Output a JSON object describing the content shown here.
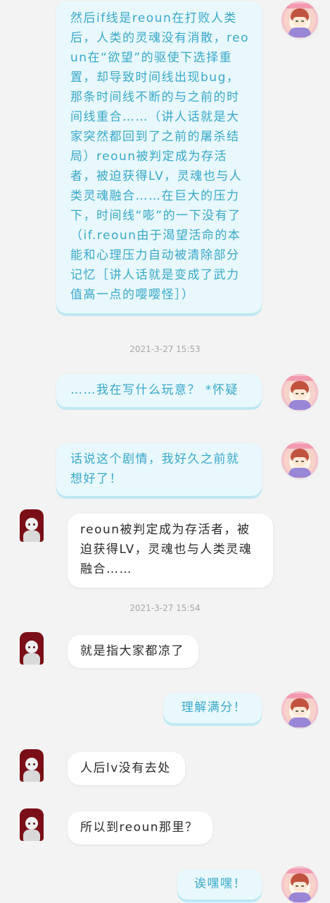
{
  "messages": [
    {
      "id": "m1",
      "side": "me",
      "text": "然后if线是reoun在打败人类后，人类的灵魂没有消散，reoun在“欲望”的驱使下选择重置，却导致时间线出现bug，那条时间线不断的与之前的时间线重合……（讲人话就是大家突然都回到了之前的屠杀结局）reoun被判定成为存活者，被迫获得LV，灵魂也与人类灵魂融合……在巨大的压力下，时间线“嘭”的一下没有了（if.reoun由于渴望活命的本能和心理压力自动被清除部分记忆［讲人话就是变成了武力值高一点的嘤嘤怪］）"
    },
    {
      "id": "t1",
      "type": "time",
      "text": "2021-3-27 15:53"
    },
    {
      "id": "m2",
      "side": "me",
      "text": "……我在写什么玩意？ *怀疑"
    },
    {
      "id": "m3",
      "side": "me",
      "text": "话说这个剧情，我好久之前就想好了！"
    },
    {
      "id": "m4",
      "side": "them",
      "text": "reoun被判定成为存活者，被迫获得LV，灵魂也与人类灵魂融合……"
    },
    {
      "id": "t2",
      "type": "time",
      "text": "2021-3-27 15:54"
    },
    {
      "id": "m5",
      "side": "them",
      "text": "就是指大家都凉了"
    },
    {
      "id": "m6",
      "side": "me",
      "text": "理解满分！"
    },
    {
      "id": "m7",
      "side": "them",
      "text": "人后lv没有去处"
    },
    {
      "id": "m8",
      "side": "them",
      "text": "所以到reoun那里？"
    },
    {
      "id": "m9",
      "side": "me",
      "text": "诶嘿嘿！"
    }
  ],
  "colors": {
    "background": "#f3f3f3",
    "me_bubble": "#e8f8fc",
    "me_text": "#3aa8c8",
    "them_bubble": "#ffffff",
    "them_text": "#2a2a2a",
    "timestamp": "#a9a9a9"
  },
  "avatars": {
    "me": "anime-character-avatar",
    "them": "anime-character-avatar-dark-red"
  }
}
